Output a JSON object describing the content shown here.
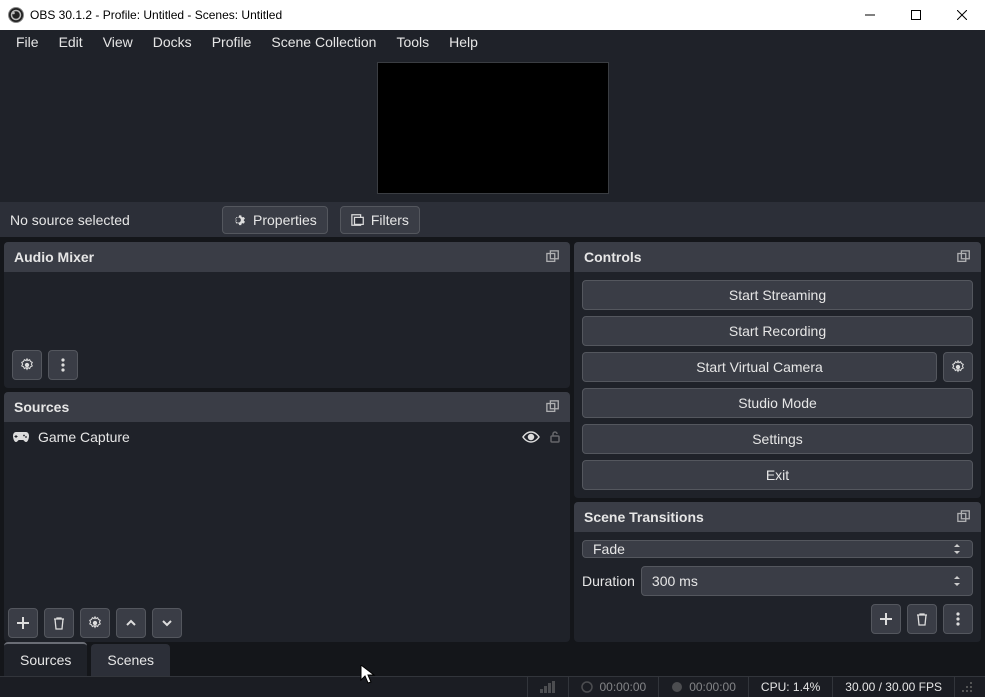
{
  "window": {
    "title": "OBS 30.1.2 - Profile: Untitled - Scenes: Untitled"
  },
  "menu": {
    "items": [
      "File",
      "Edit",
      "View",
      "Docks",
      "Profile",
      "Scene Collection",
      "Tools",
      "Help"
    ]
  },
  "context_toolbar": {
    "status": "No source selected",
    "properties_label": "Properties",
    "filters_label": "Filters"
  },
  "panels": {
    "audio_mixer": {
      "title": "Audio Mixer"
    },
    "sources": {
      "title": "Sources",
      "items": [
        {
          "icon": "gamepad-icon",
          "name": "Game Capture"
        }
      ]
    },
    "controls": {
      "title": "Controls",
      "start_streaming": "Start Streaming",
      "start_recording": "Start Recording",
      "start_virtual_camera": "Start Virtual Camera",
      "studio_mode": "Studio Mode",
      "settings": "Settings",
      "exit": "Exit"
    },
    "scene_transitions": {
      "title": "Scene Transitions",
      "selected": "Fade",
      "duration_label": "Duration",
      "duration_value": "300 ms"
    }
  },
  "tabs": {
    "sources": "Sources",
    "scenes": "Scenes"
  },
  "statusbar": {
    "live_time": "00:00:00",
    "rec_time": "00:00:00",
    "cpu": "CPU: 1.4%",
    "fps": "30.00 / 30.00 FPS"
  }
}
